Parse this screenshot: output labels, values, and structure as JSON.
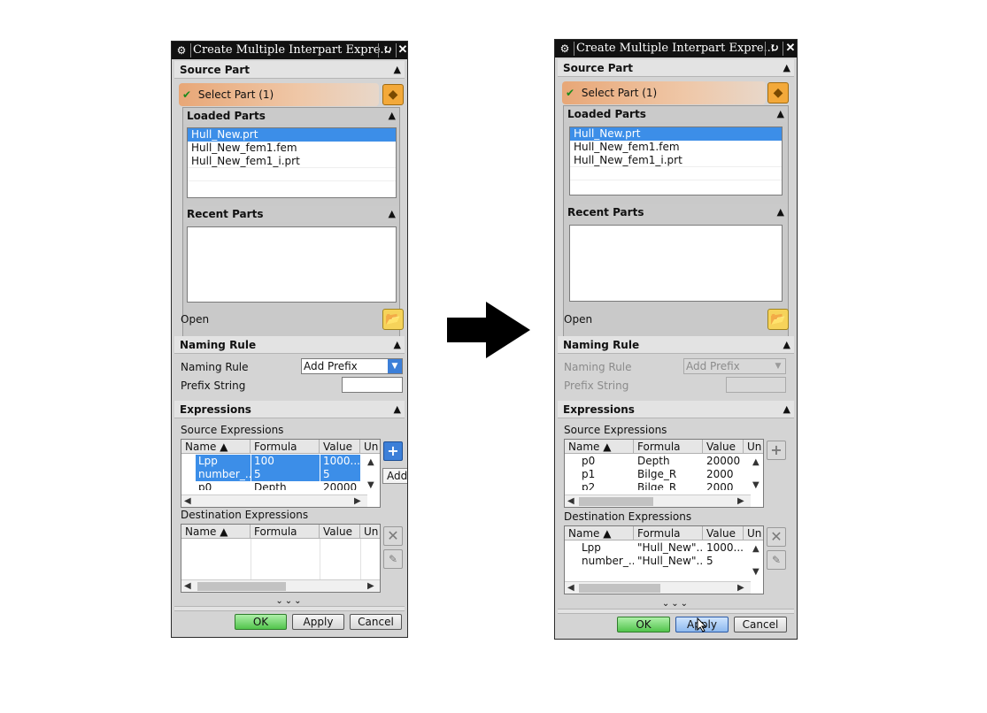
{
  "dialog_before": {
    "title": "Create Multiple Interpart Expre...",
    "icons": {
      "settings": "gear-icon",
      "reset": "reset-icon",
      "close": "close-icon"
    },
    "source_part": {
      "header": "Source Part",
      "select_part": "Select Part (1)",
      "loaded_parts": {
        "header": "Loaded Parts",
        "items": [
          "Hull_New.prt",
          "Hull_New_fem1.fem",
          "Hull_New_fem1_i.prt"
        ],
        "selected_index": 0
      },
      "recent_parts": {
        "header": "Recent Parts",
        "items": []
      },
      "open_label": "Open"
    },
    "naming_rule": {
      "header": "Naming Rule",
      "rule_label": "Naming Rule",
      "rule_value": "Add Prefix",
      "prefix_label": "Prefix String",
      "prefix_value": ""
    },
    "expressions": {
      "header": "Expressions",
      "source": {
        "label": "Source Expressions",
        "columns": [
          "Name",
          "Formula",
          "Value",
          "Un"
        ],
        "rows": [
          {
            "name": "Lpp",
            "formula": "100",
            "value": "1000...",
            "selected": true
          },
          {
            "name": "number_...",
            "formula": "5",
            "value": "5",
            "selected": true
          },
          {
            "name": "p0",
            "formula": "Depth",
            "value": "20000",
            "selected": false
          }
        ]
      },
      "destination": {
        "label": "Destination Expressions",
        "columns": [
          "Name",
          "Formula",
          "Value",
          "Un"
        ],
        "rows": []
      },
      "add_tooltip": "Add"
    },
    "buttons": {
      "ok": "OK",
      "apply": "Apply",
      "cancel": "Cancel"
    }
  },
  "dialog_after": {
    "title": "Create Multiple Interpart Expre...",
    "icons": {
      "settings": "gear-icon",
      "reset": "reset-icon",
      "close": "close-icon"
    },
    "source_part": {
      "header": "Source Part",
      "select_part": "Select Part (1)",
      "loaded_parts": {
        "header": "Loaded Parts",
        "items": [
          "Hull_New.prt",
          "Hull_New_fem1.fem",
          "Hull_New_fem1_i.prt"
        ],
        "selected_index": 0
      },
      "recent_parts": {
        "header": "Recent Parts",
        "items": []
      },
      "open_label": "Open"
    },
    "naming_rule": {
      "header": "Naming Rule",
      "rule_label": "Naming Rule",
      "rule_value": "Add Prefix",
      "prefix_label": "Prefix String",
      "prefix_value": "",
      "disabled": true
    },
    "expressions": {
      "header": "Expressions",
      "source": {
        "label": "Source Expressions",
        "columns": [
          "Name",
          "Formula",
          "Value",
          "Un"
        ],
        "rows": [
          {
            "name": "p0",
            "formula": "Depth",
            "value": "20000"
          },
          {
            "name": "p1",
            "formula": "Bilge_R",
            "value": "2000"
          },
          {
            "name": "p2",
            "formula": "Bilge_R",
            "value": "2000"
          }
        ]
      },
      "destination": {
        "label": "Destination Expressions",
        "columns": [
          "Name",
          "Formula",
          "Value",
          "Un"
        ],
        "rows": [
          {
            "name": "Lpp",
            "formula": "\"Hull_New\"...",
            "value": "1000..."
          },
          {
            "name": "number_...",
            "formula": "\"Hull_New\"...",
            "value": "5"
          }
        ]
      }
    },
    "buttons": {
      "ok": "OK",
      "apply": "Apply",
      "cancel": "Cancel"
    }
  },
  "transition_arrow": "right-arrow"
}
